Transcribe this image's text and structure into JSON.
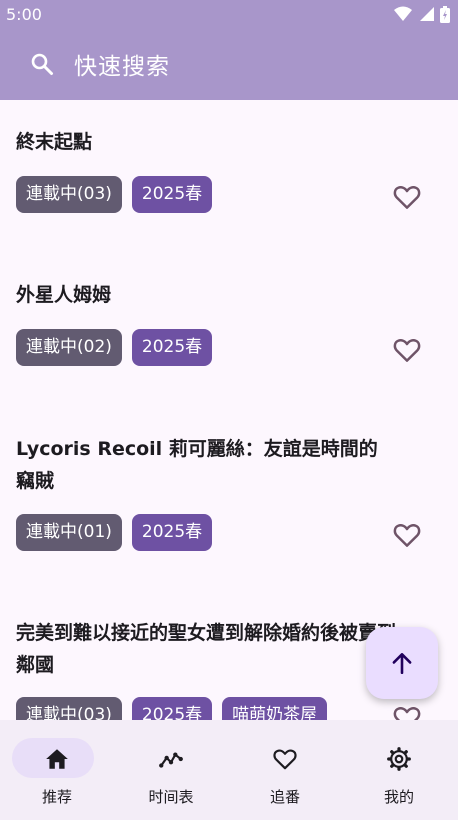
{
  "status_bar": {
    "time": "5:00"
  },
  "search": {
    "placeholder": "快速搜索"
  },
  "items": [
    {
      "title": "終末起點",
      "status": "連載中(03)",
      "season": "2025春"
    },
    {
      "title": "外星人姆姆",
      "status": "連載中(02)",
      "season": "2025春"
    },
    {
      "title": "Lycoris Recoil 莉可麗絲：友誼是時間的竊賊",
      "status": "連載中(01)",
      "season": "2025春"
    },
    {
      "title": "完美到難以接近的聖女遭到解除婚約後被賣到鄰國",
      "status": "連載中(03)",
      "season": "2025春",
      "group": "喵萌奶茶屋"
    }
  ],
  "fab": {
    "icon": "arrow-up-icon"
  },
  "bottom_nav": [
    {
      "label": "推荐",
      "icon": "home-icon",
      "selected": true
    },
    {
      "label": "时间表",
      "icon": "timeline-icon",
      "selected": false
    },
    {
      "label": "追番",
      "icon": "heart-icon",
      "selected": false
    },
    {
      "label": "我的",
      "icon": "gear-icon",
      "selected": false
    }
  ],
  "colors": {
    "app_bar": "#a896ca",
    "background": "#fdf7fe",
    "status_chip": "#625b71",
    "season_chip": "#6e51a3",
    "fab": "#eaddff",
    "nav_bar": "#f3edf7",
    "nav_indicator": "#e8def8"
  }
}
